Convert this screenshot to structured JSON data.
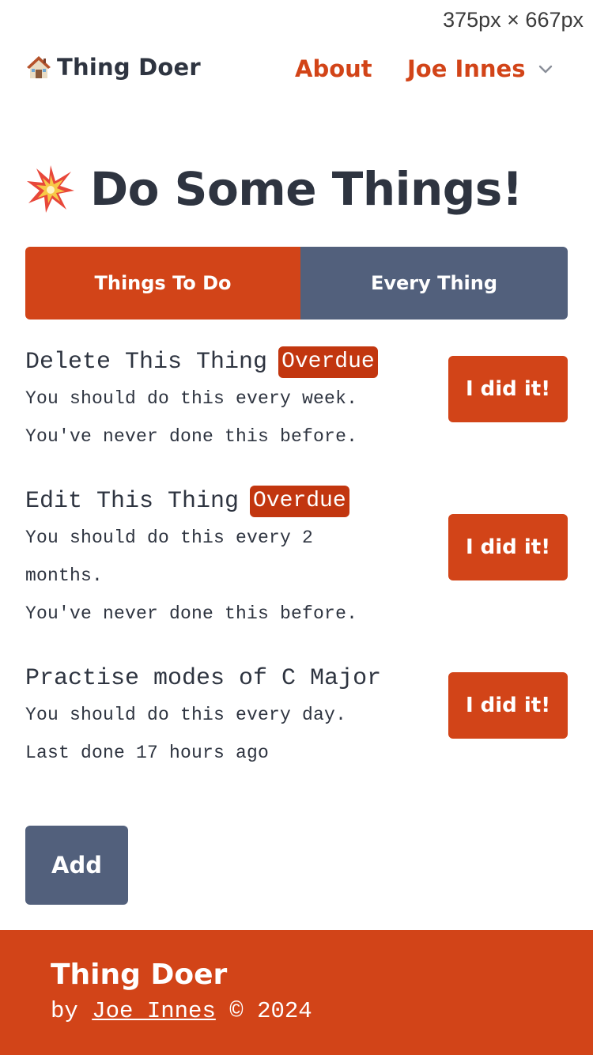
{
  "viewport_label": "375px × 667px",
  "nav": {
    "brand": "Thing Doer",
    "brand_icon": "house-icon",
    "about": "About",
    "user": "Joe Innes",
    "user_menu_icon": "chevron-down-icon"
  },
  "page": {
    "title": "Do Some Things!",
    "title_icon": "collision-icon"
  },
  "tabs": [
    {
      "label": "Things To Do",
      "active": true
    },
    {
      "label": "Every Thing",
      "active": false
    }
  ],
  "things": [
    {
      "title": "Delete This Thing",
      "badge": "Overdue",
      "frequency": "You should do this every week.",
      "last_done": "You've never done this before.",
      "button": "I did it!"
    },
    {
      "title": "Edit This Thing",
      "badge": "Overdue",
      "frequency": "You should do this every 2 months.",
      "last_done": "You've never done this before.",
      "button": "I did it!"
    },
    {
      "title": "Practise modes of C Major",
      "badge": "",
      "frequency": "You should do this every day.",
      "last_done": "Last done 17 hours ago",
      "button": "I did it!"
    }
  ],
  "add_button": "Add",
  "footer": {
    "title": "Thing Doer",
    "by": "by",
    "author": "Joe Innes",
    "copyright": "© 2024"
  },
  "colors": {
    "accent": "#d24418",
    "badge": "#c2360f",
    "slate": "#52607c",
    "text": "#2e3440"
  }
}
